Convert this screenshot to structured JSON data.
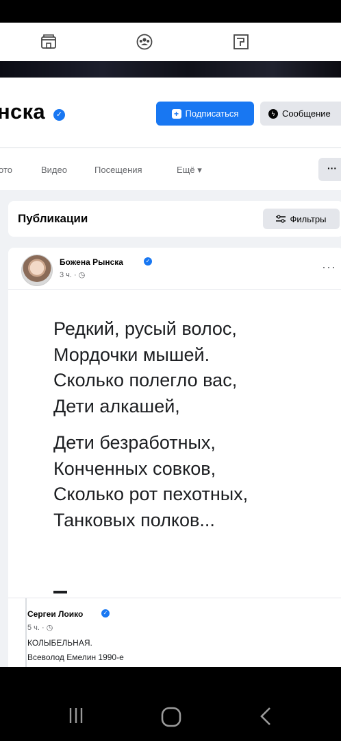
{
  "profile": {
    "name_fragment": "нска",
    "subscribe_label": "Подписаться",
    "message_label": "Сообщение"
  },
  "tabs": [
    {
      "label": "ото"
    },
    {
      "label": "Видео"
    },
    {
      "label": "Посещения"
    },
    {
      "label": "Ещё ▾"
    }
  ],
  "tabs_more": "···",
  "feed": {
    "section_title": "Публикации",
    "filter_label": "Фильтры"
  },
  "post": {
    "author": "Божена Рынска",
    "time": "3 ч. · ◷",
    "menu": "···",
    "stanza1": [
      "Редкий, русый волос,",
      "Мордочки мышей.",
      "Сколько полегло вас,",
      "Дети алкашей,"
    ],
    "stanza2": [
      "Дети безработных,",
      "Конченных совков,",
      "Сколько рот пехотных,",
      "Танковых полков..."
    ]
  },
  "shared": {
    "author": "Сергеи Лоико",
    "time": "5 ч. · ◷",
    "title": "КОЛЫБЕЛЬНАЯ.",
    "subtitle": "Всеволод Емелин 1990-е"
  },
  "icons": {
    "top": [
      "store-icon",
      "groups-icon",
      "pages-icon"
    ],
    "nav": [
      "recents-icon",
      "home-icon",
      "back-icon"
    ]
  },
  "colors": {
    "brand": "#1877f2",
    "feed_bg": "#f0f2f5",
    "button_gray": "#e4e6eb"
  }
}
